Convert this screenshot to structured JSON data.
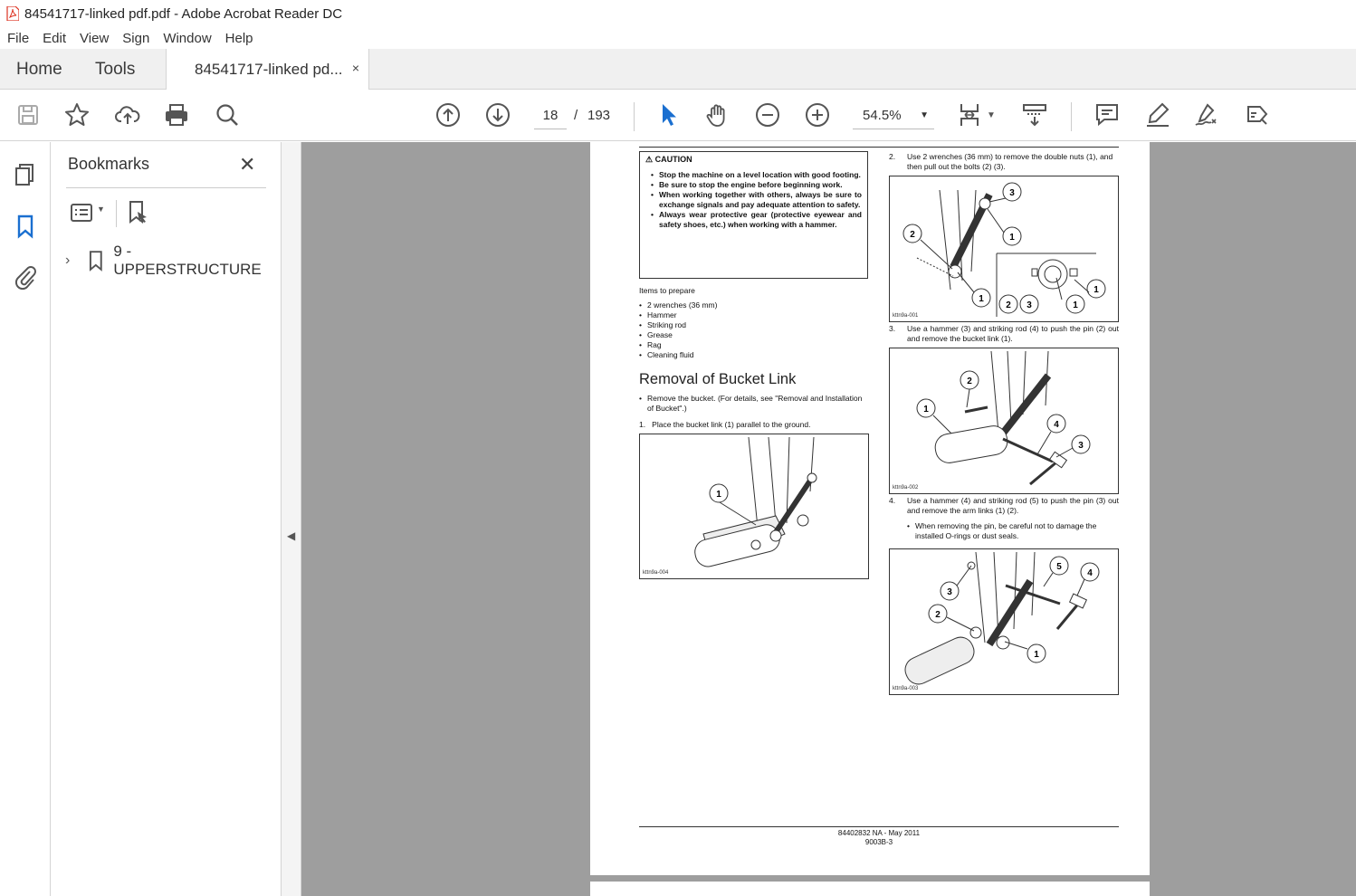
{
  "window": {
    "title": "84541717-linked pdf.pdf - Adobe Acrobat Reader DC"
  },
  "menu": [
    "File",
    "Edit",
    "View",
    "Sign",
    "Window",
    "Help"
  ],
  "tabs": {
    "home": "Home",
    "tools": "Tools",
    "document": "84541717-linked pd...",
    "close": "×"
  },
  "toolbar": {
    "page_current": "18",
    "page_sep": "/",
    "page_total": "193",
    "zoom": "54.5%"
  },
  "bookmarks": {
    "title": "Bookmarks",
    "items": [
      {
        "label": "9 - UPPERSTRUCTURE"
      }
    ]
  },
  "document": {
    "caution_title": "CAUTION",
    "caution_items": [
      "Stop the machine on a level location with good footing.",
      "Be sure to stop the engine before beginning work.",
      "When working together with others, always be sure to exchange signals and pay adequate attention to safety.",
      "Always wear protective gear (protective eyewear and safety shoes, etc.) when working with a hammer."
    ],
    "items_heading": "Items to prepare",
    "items": [
      "2 wrenches (36 mm)",
      "Hammer",
      "Striking rod",
      "Grease",
      "Rag",
      "Cleaning fluid"
    ],
    "section_title": "Removal of Bucket Link",
    "section_bullet": "Remove the bucket. (For details, see \"Removal and Installation of Bucket\".)",
    "step1": "1.   Place the bucket link (1) parallel to the ground.",
    "step2": "Use 2 wrenches (36 mm) to remove the double nuts (1), and then pull out the bolts (2) (3).",
    "step3": "Use a hammer (3) and striking rod (4) to push the pin (2) out and remove the bucket link (1).",
    "step4": "Use a hammer (4) and striking rod (5) to push the pin (3) out and remove the arm links (1) (2).",
    "step4_note": "When removing the pin, be careful not to damage the installed O-rings or dust seals.",
    "step2_num": "2.",
    "step3_num": "3.",
    "step4_num": "4.",
    "fig_codes": [
      "kttn9a-004",
      "kttn9a-001",
      "kttn9a-002",
      "kttn9a-003"
    ],
    "footer_line1": "84402832 NA - May 2011",
    "footer_line2": "9003B-3"
  }
}
